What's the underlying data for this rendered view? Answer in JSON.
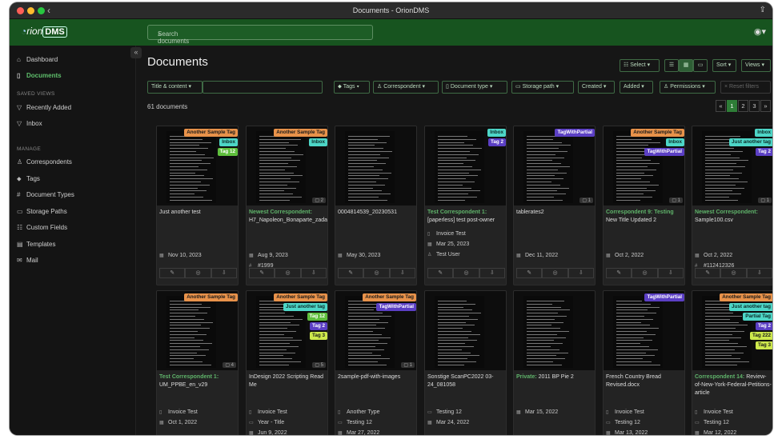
{
  "window": {
    "title": "Documents - OrionDMS"
  },
  "app": {
    "logo_prefix": "rion",
    "logo_badge": "DMS",
    "search_placeholder": "Search documents"
  },
  "sidebar": {
    "items": [
      {
        "label": "Dashboard",
        "icon": "house-icon"
      },
      {
        "label": "Documents",
        "icon": "file-icon"
      }
    ],
    "saved_views_header": "SAVED VIEWS",
    "saved_views": [
      {
        "label": "Recently Added",
        "icon": "funnel-icon"
      },
      {
        "label": "Inbox",
        "icon": "funnel-icon"
      }
    ],
    "manage_header": "MANAGE",
    "manage": [
      {
        "label": "Correspondents",
        "icon": "person-icon"
      },
      {
        "label": "Tags",
        "icon": "tag-icon"
      },
      {
        "label": "Document Types",
        "icon": "hash-icon"
      },
      {
        "label": "Storage Paths",
        "icon": "folder-icon"
      },
      {
        "label": "Custom Fields",
        "icon": "fields-icon"
      },
      {
        "label": "Templates",
        "icon": "template-icon"
      },
      {
        "label": "Mail",
        "icon": "mail-icon"
      }
    ]
  },
  "page": {
    "title": "Documents",
    "count": "61 documents"
  },
  "toolbar": {
    "select": "Select",
    "sort": "Sort",
    "views": "Views"
  },
  "filters": {
    "title_content": "Title & content",
    "tags": "Tags",
    "correspondent": "Correspondent",
    "document_type": "Document type",
    "storage_path": "Storage path",
    "created": "Created",
    "added": "Added",
    "permissions": "Permissions",
    "reset": "Reset filters"
  },
  "pagination": [
    "«",
    "1",
    "2",
    "3",
    "»"
  ],
  "colors": {
    "accent": "#17541f",
    "orange": "#e8924a",
    "teal": "#4dd6c7",
    "green": "#5fbf3d",
    "purple": "#5b3fc4",
    "lime": "#cde84c"
  },
  "cards": [
    {
      "title": "Just another test",
      "correspondent": "",
      "tags": [
        {
          "t": "Another Sample Tag",
          "c": "orange"
        },
        {
          "t": "Inbox",
          "c": "teal"
        },
        {
          "t": "Tag 12",
          "c": "green"
        }
      ],
      "notes": "",
      "meta": [
        {
          "i": "calendar-icon",
          "t": "Nov 10, 2023"
        }
      ]
    },
    {
      "title": "H7_Napoleon_Bonaparte_zadanie",
      "correspondent": "Newest Correspondent:",
      "tags": [
        {
          "t": "Another Sample Tag",
          "c": "orange"
        },
        {
          "t": "Inbox",
          "c": "teal"
        }
      ],
      "notes": "2",
      "meta": [
        {
          "i": "calendar-icon",
          "t": "Aug 9, 2023"
        },
        {
          "i": "hash-icon",
          "t": "#1999"
        }
      ]
    },
    {
      "title": "0004814539_20230531",
      "correspondent": "",
      "tags": [],
      "notes": "",
      "meta": [
        {
          "i": "calendar-icon",
          "t": "May 30, 2023"
        }
      ]
    },
    {
      "title": "[paperless] test post-owner",
      "correspondent": "Test Correspondent 1:",
      "tags": [
        {
          "t": "Inbox",
          "c": "teal"
        },
        {
          "t": "Tag 2",
          "c": "purple"
        }
      ],
      "notes": "",
      "meta": [
        {
          "i": "file-icon",
          "t": "Invoice Test"
        },
        {
          "i": "calendar-icon",
          "t": "Mar 25, 2023"
        },
        {
          "i": "person-icon",
          "t": "Test User"
        }
      ]
    },
    {
      "title": "tablerates2",
      "correspondent": "",
      "tags": [
        {
          "t": "TagWithPartial",
          "c": "purple"
        }
      ],
      "notes": "1",
      "meta": [
        {
          "i": "calendar-icon",
          "t": "Dec 11, 2022"
        }
      ]
    },
    {
      "title": "New Title Updated 2",
      "correspondent": "Correspondent 9: Testing",
      "tags": [
        {
          "t": "Another Sample Tag",
          "c": "orange"
        },
        {
          "t": "Inbox",
          "c": "teal"
        },
        {
          "t": "TagWithPartial",
          "c": "purple"
        }
      ],
      "notes": "1",
      "meta": [
        {
          "i": "calendar-icon",
          "t": "Oct 2, 2022"
        }
      ]
    },
    {
      "title": "Sample100.csv",
      "correspondent": "Newest Correspondent:",
      "tags": [
        {
          "t": "Inbox",
          "c": "teal"
        },
        {
          "t": "Just another tag",
          "c": "teal"
        },
        {
          "t": "Tag 2",
          "c": "purple"
        }
      ],
      "notes": "1",
      "meta": [
        {
          "i": "calendar-icon",
          "t": "Oct 2, 2022"
        },
        {
          "i": "hash-icon",
          "t": "#112412326"
        }
      ]
    },
    {
      "title": "UM_PPBE_en_v29",
      "correspondent": "Test Correspondent 1:",
      "tags": [
        {
          "t": "Another Sample Tag",
          "c": "orange"
        }
      ],
      "notes": "4",
      "meta": [
        {
          "i": "file-icon",
          "t": "Invoice Test"
        },
        {
          "i": "calendar-icon",
          "t": "Oct 1, 2022"
        }
      ]
    },
    {
      "title": "InDesign 2022 Scripting Read Me",
      "correspondent": "",
      "tags": [
        {
          "t": "Another Sample Tag",
          "c": "orange"
        },
        {
          "t": "Just another tag",
          "c": "teal"
        },
        {
          "t": "Tag 12",
          "c": "green"
        },
        {
          "t": "Tag 2",
          "c": "purple"
        },
        {
          "t": "Tag 3",
          "c": "lime"
        }
      ],
      "notes": "5",
      "meta": [
        {
          "i": "file-icon",
          "t": "Invoice Test"
        },
        {
          "i": "folder-icon",
          "t": "Year - Title"
        },
        {
          "i": "calendar-icon",
          "t": "Jun 9, 2022"
        }
      ]
    },
    {
      "title": "2sample-pdf-with-images",
      "correspondent": "",
      "tags": [
        {
          "t": "Another Sample Tag",
          "c": "orange"
        },
        {
          "t": "TagWithPartial",
          "c": "purple"
        }
      ],
      "notes": "1",
      "meta": [
        {
          "i": "file-icon",
          "t": "Another Type"
        },
        {
          "i": "folder-icon",
          "t": "Testing 12"
        },
        {
          "i": "calendar-icon",
          "t": "Mar 27, 2022"
        }
      ]
    },
    {
      "title": "Sonstige ScanPC2022 03-24_081058",
      "correspondent": "",
      "tags": [],
      "notes": "",
      "meta": [
        {
          "i": "folder-icon",
          "t": "Testing 12"
        },
        {
          "i": "calendar-icon",
          "t": "Mar 24, 2022"
        }
      ]
    },
    {
      "title": "2011 BP Pie 2",
      "correspondent": "Private:",
      "tags": [],
      "notes": "",
      "meta": [
        {
          "i": "calendar-icon",
          "t": "Mar 15, 2022"
        }
      ]
    },
    {
      "title": "French Country Bread Revised.docx",
      "correspondent": "",
      "tags": [
        {
          "t": "TagWithPartial",
          "c": "purple"
        }
      ],
      "notes": "",
      "meta": [
        {
          "i": "file-icon",
          "t": "Invoice Test"
        },
        {
          "i": "folder-icon",
          "t": "Testing 12"
        },
        {
          "i": "calendar-icon",
          "t": "Mar 13, 2022"
        }
      ]
    },
    {
      "title": "Review-of-New-York-Federal-Petitions-article",
      "correspondent": "Correspondent 14:",
      "tags": [
        {
          "t": "Another Sample Tag",
          "c": "orange"
        },
        {
          "t": "Just another tag",
          "c": "teal"
        },
        {
          "t": "Partial Tag",
          "c": "teal"
        },
        {
          "t": "Tag 2",
          "c": "purple"
        },
        {
          "t": "Tag 222",
          "c": "lime"
        },
        {
          "t": "Tag 3",
          "c": "lime"
        }
      ],
      "notes": "",
      "meta": [
        {
          "i": "file-icon",
          "t": "Invoice Test"
        },
        {
          "i": "folder-icon",
          "t": "Testing 12"
        },
        {
          "i": "calendar-icon",
          "t": "Mar 12, 2022"
        }
      ]
    }
  ]
}
